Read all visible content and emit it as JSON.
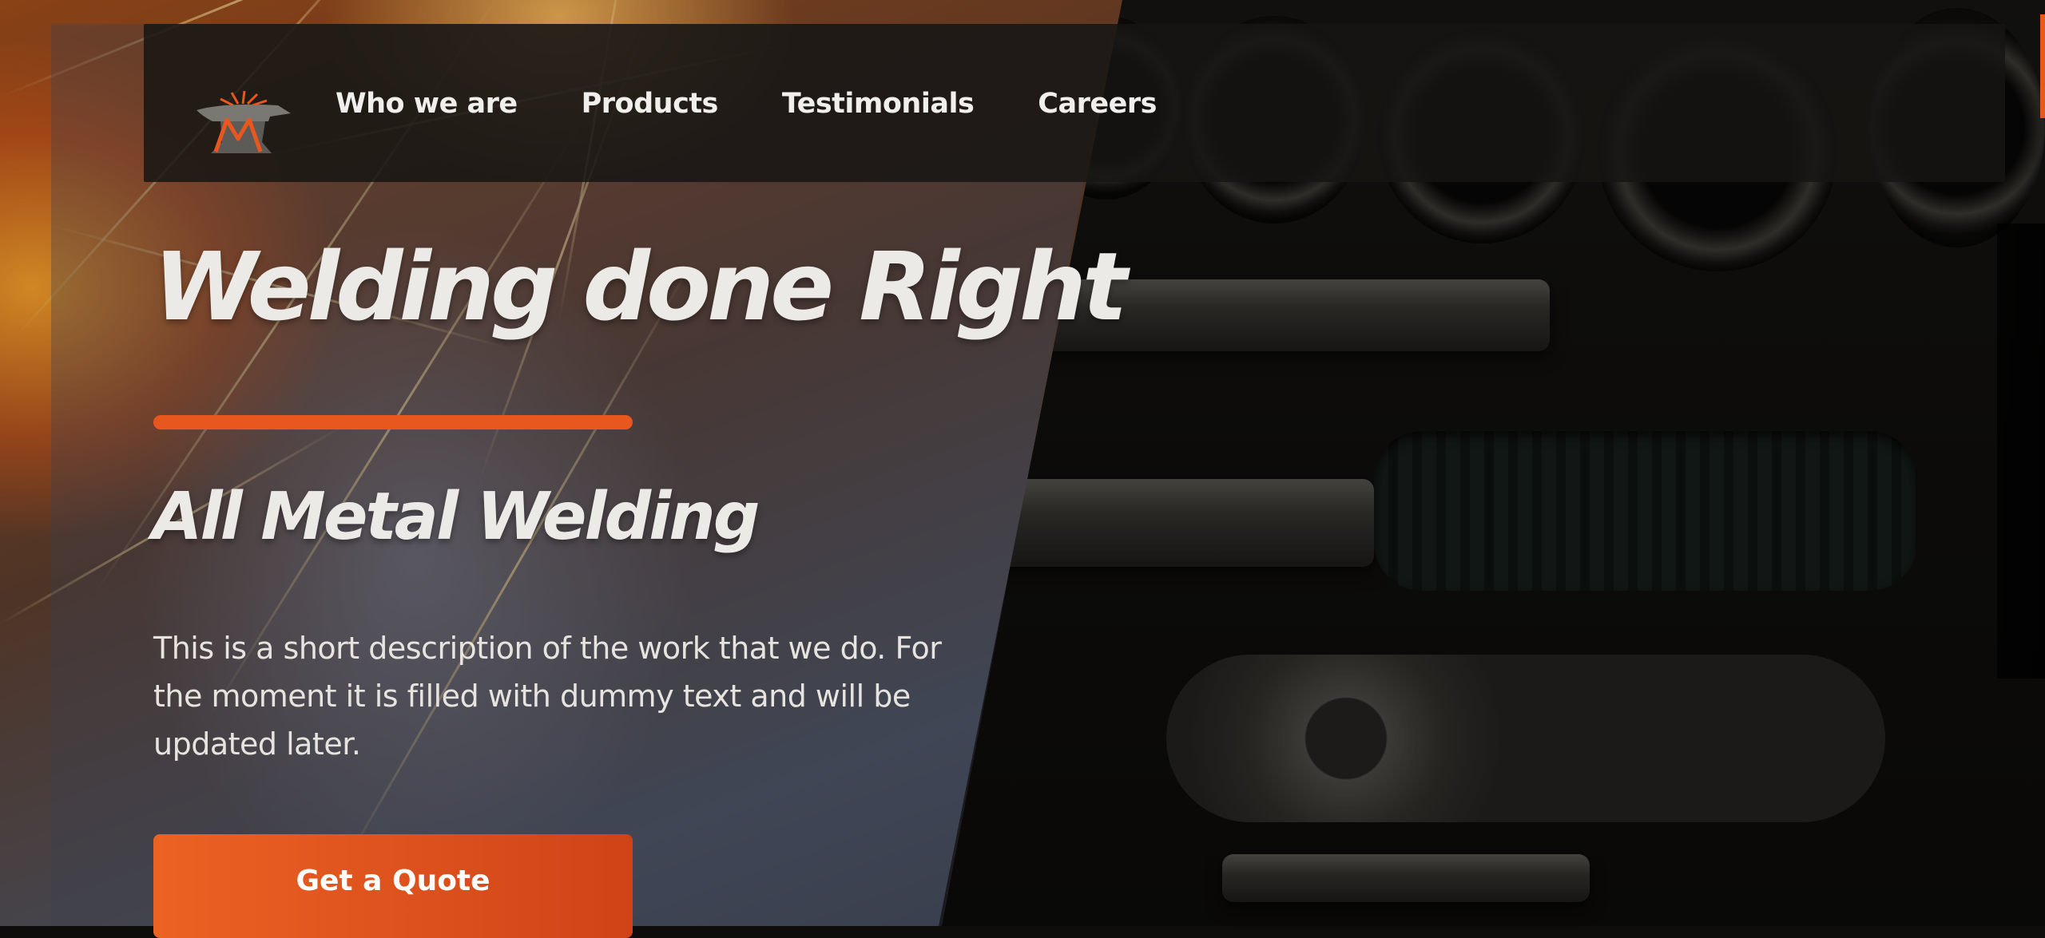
{
  "nav": {
    "items": [
      {
        "label": "Who we are"
      },
      {
        "label": "Products"
      },
      {
        "label": "Testimonials"
      },
      {
        "label": "Careers"
      }
    ]
  },
  "logo": {
    "icon": "anvil-logo-icon"
  },
  "hero": {
    "title": "Welding done Right",
    "subtitle": "All Metal Welding",
    "description": "This is a short description of the work that we do. For the moment it is filled with dummy text and will be updated later.",
    "cta_label": "Get a Quote"
  },
  "colors": {
    "accent": "#e8571d",
    "text": "#eceae6",
    "nav_bg": "#161513"
  }
}
